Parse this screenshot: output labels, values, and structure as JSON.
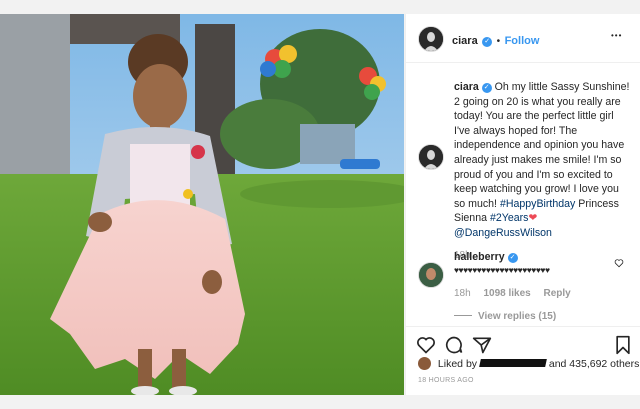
{
  "post": {
    "username": "ciara",
    "follow_label": "Follow",
    "separator": "•",
    "more_label": "•••"
  },
  "caption": {
    "username": "ciara",
    "text": "Oh my little Sassy Sunshine! 2 going on 20 is what you really are today! You are the perfect little girl I've always hoped for! The independence and opinion you have already just makes me smile! I'm so proud of you and I'm so excited to keep watching you grow! I love you so much!",
    "hashtag1": "#HappyBirthday",
    "text2": "Princess Sienna",
    "hashtag2": "#2Years",
    "emoji": "❤",
    "mention": "@DangeRussWilson",
    "time": "18h"
  },
  "comment": {
    "username": "halleberry",
    "text": "♥♥♥♥♥♥♥♥♥♥♥♥♥♥♥♥♥♥♥♥♥",
    "time": "18h",
    "likes": "1098 likes",
    "reply_label": "Reply",
    "view_replies": "View replies (15)"
  },
  "likes": {
    "prefix": "Liked by",
    "suffix": "and 435,692 others",
    "timestamp": "18 HOURS AGO"
  },
  "icons": {
    "verified": "✓"
  },
  "colors": {
    "link_blue": "#3897f0",
    "hashtag_navy": "#003569",
    "heart_red": "#ed4956"
  }
}
